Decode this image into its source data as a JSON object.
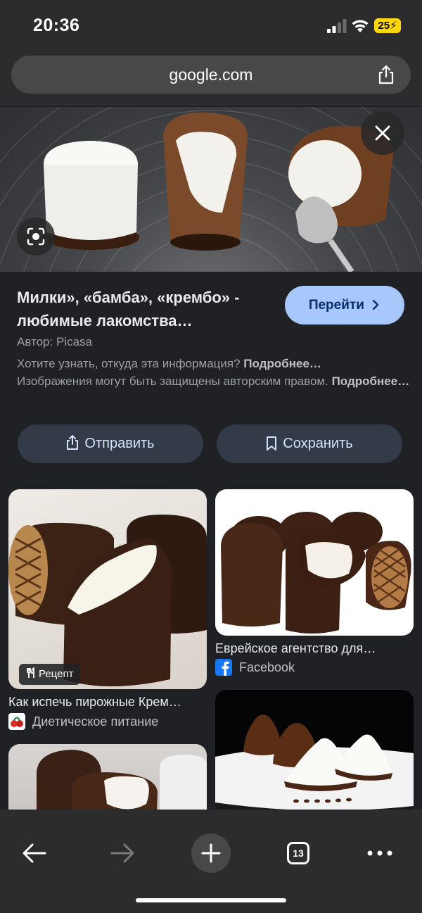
{
  "status_bar": {
    "time": "20:36",
    "battery": "25"
  },
  "address_bar": {
    "url": "google.com"
  },
  "result": {
    "title": "Милки», «бамба», «крембо» - любимые лакомства…",
    "visit_label": "Перейти",
    "author": "Автор: Picasa",
    "note_1": "Хотите узнать, откуда эта информация?",
    "more_1": "Подробнее…",
    "note_2": "Изображения могут быть защищены авторским правом.",
    "more_2": "Подробнее…",
    "share_label": "Отправить",
    "save_label": "Сохранить"
  },
  "related": [
    {
      "title": "Как испечь пирожные Крем…",
      "source": "Диетическое питание",
      "badge": "Рецепт"
    },
    {
      "title": "Еврейское агентство для…",
      "source": "Facebook"
    }
  ],
  "toolbar": {
    "tab_count": "13"
  },
  "colors": {
    "accent": "#a8c7fa",
    "pill": "#343b48",
    "background": "#202124"
  },
  "icons": [
    "signal-icon",
    "wifi-icon",
    "share-icon",
    "close-icon",
    "lens-icon",
    "chevron-right-icon",
    "bookmark-icon",
    "utensils-icon",
    "facebook-icon",
    "back-icon",
    "forward-icon",
    "plus-icon",
    "tabs-icon",
    "more-icon"
  ]
}
